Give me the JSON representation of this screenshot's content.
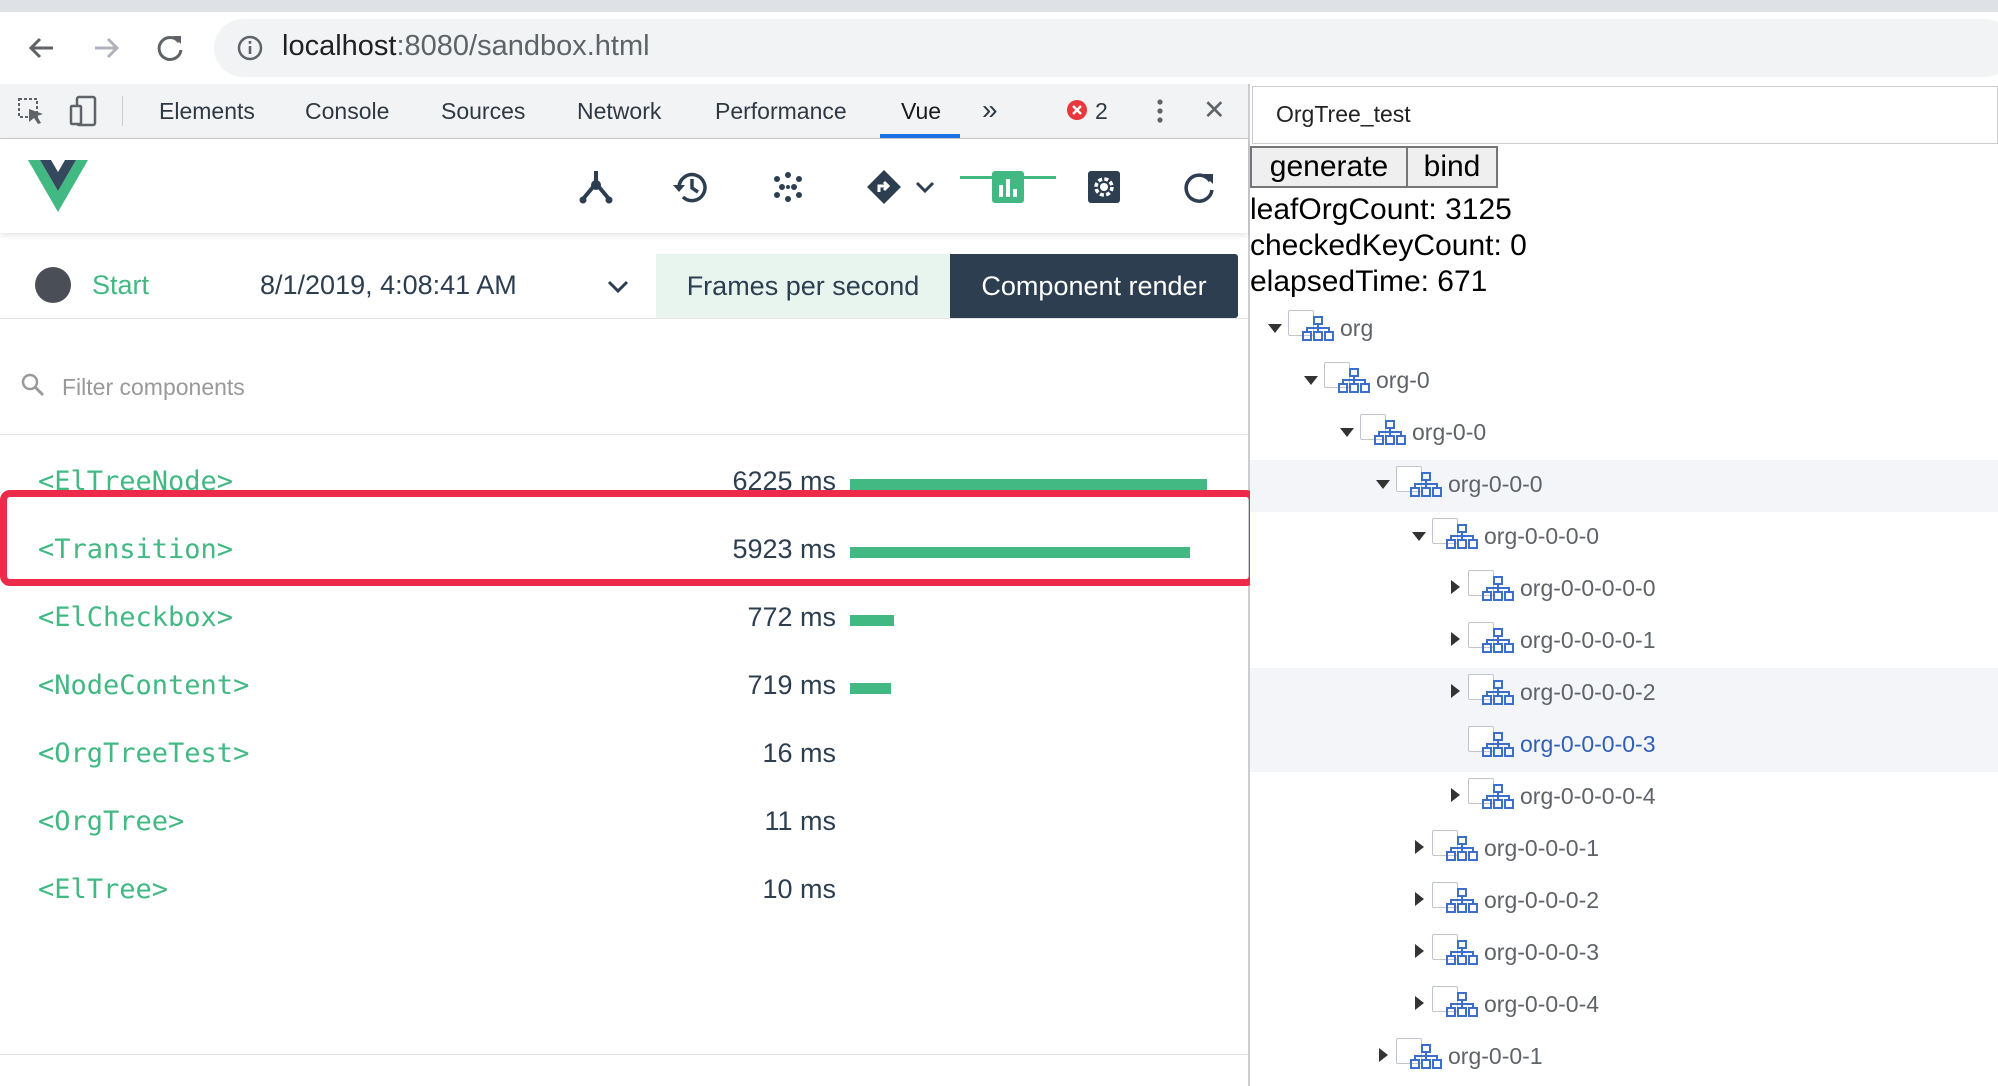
{
  "browser": {
    "url_host": "localhost",
    "url_port": ":8080",
    "url_path": "/sandbox.html",
    "back_icon": "arrow-left",
    "forward_icon": "arrow-right",
    "reload_icon": "reload",
    "info_icon": "info-circle"
  },
  "devtools": {
    "tabs": [
      "Elements",
      "Console",
      "Sources",
      "Network",
      "Performance",
      "Vue"
    ],
    "active_tab": "Vue",
    "more_label": "»",
    "error_count": "2",
    "close_label": "✕"
  },
  "vue": {
    "start_label": "Start",
    "timestamp": "8/1/2019, 4:08:41 AM",
    "fps_label": "Frames per second",
    "render_label": "Component render",
    "filter_placeholder": "Filter components",
    "components": [
      {
        "name": "<ElTreeNode>",
        "time": "6225 ms",
        "ms": 6225
      },
      {
        "name": "<Transition>",
        "time": "5923 ms",
        "ms": 5923
      },
      {
        "name": "<ElCheckbox>",
        "time": "772 ms",
        "ms": 772
      },
      {
        "name": "<NodeContent>",
        "time": "719 ms",
        "ms": 719
      },
      {
        "name": "<OrgTreeTest>",
        "time": "16 ms",
        "ms": 16
      },
      {
        "name": "<OrgTree>",
        "time": "11 ms",
        "ms": 11
      },
      {
        "name": "<ElTree>",
        "time": "10 ms",
        "ms": 10
      }
    ]
  },
  "app": {
    "tab_title": "OrgTree_test",
    "generate_label": "generate",
    "bind_label": "bind",
    "stats": [
      "leafOrgCount: 3125",
      "checkedKeyCount: 0",
      "elapsedTime: 671"
    ],
    "tree": [
      {
        "label": "org",
        "caret": "down"
      },
      {
        "label": "org-0",
        "caret": "down"
      },
      {
        "label": "org-0-0",
        "caret": "down"
      },
      {
        "label": "org-0-0-0",
        "caret": "down"
      },
      {
        "label": "org-0-0-0-0",
        "caret": "down"
      },
      {
        "label": "org-0-0-0-0-0",
        "caret": "right"
      },
      {
        "label": "org-0-0-0-0-1",
        "caret": "right"
      },
      {
        "label": "org-0-0-0-0-2",
        "caret": "right"
      },
      {
        "label": "org-0-0-0-0-3",
        "caret": "none"
      },
      {
        "label": "org-0-0-0-0-4",
        "caret": "right"
      },
      {
        "label": "org-0-0-0-1",
        "caret": "right"
      },
      {
        "label": "org-0-0-0-2",
        "caret": "right"
      },
      {
        "label": "org-0-0-0-3",
        "caret": "right"
      },
      {
        "label": "org-0-0-0-4",
        "caret": "right"
      },
      {
        "label": "org-0-0-1",
        "caret": "right"
      }
    ]
  }
}
